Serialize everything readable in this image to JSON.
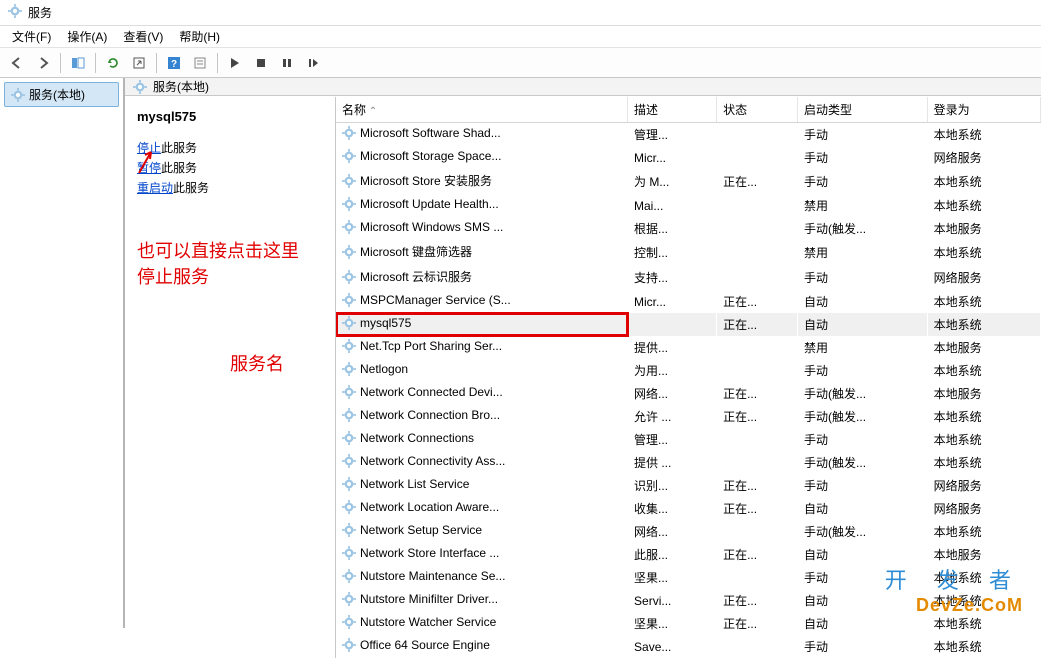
{
  "window": {
    "title": "服务"
  },
  "menu": {
    "file": "文件(F)",
    "action": "操作(A)",
    "view": "查看(V)",
    "help": "帮助(H)"
  },
  "tree": {
    "root": "服务(本地)"
  },
  "pane": {
    "header": "服务(本地)"
  },
  "actions": {
    "service_name": "mysql575",
    "stop": "停止",
    "stop_rest": "此服务",
    "pause": "暂停",
    "pause_rest": "此服务",
    "restart": "重启动",
    "restart_rest": "此服务"
  },
  "annots": {
    "arrow_hint": "也可以直接点击这里\n停止服务",
    "service_name_label": "服务名"
  },
  "columns": {
    "name": "名称",
    "desc": "描述",
    "status": "状态",
    "startup": "启动类型",
    "logon": "登录为"
  },
  "services": [
    {
      "name": "Microsoft Software Shad...",
      "desc": "管理...",
      "status": "",
      "startup": "手动",
      "logon": "本地系统"
    },
    {
      "name": "Microsoft Storage Space...",
      "desc": "Micr...",
      "status": "",
      "startup": "手动",
      "logon": "网络服务"
    },
    {
      "name": "Microsoft Store 安装服务",
      "desc": "为 M...",
      "status": "正在...",
      "startup": "手动",
      "logon": "本地系统"
    },
    {
      "name": "Microsoft Update Health...",
      "desc": "Mai...",
      "status": "",
      "startup": "禁用",
      "logon": "本地系统"
    },
    {
      "name": "Microsoft Windows SMS ...",
      "desc": "根据...",
      "status": "",
      "startup": "手动(触发...",
      "logon": "本地服务"
    },
    {
      "name": "Microsoft 键盘筛选器",
      "desc": "控制...",
      "status": "",
      "startup": "禁用",
      "logon": "本地系统"
    },
    {
      "name": "Microsoft 云标识服务",
      "desc": "支持...",
      "status": "",
      "startup": "手动",
      "logon": "网络服务"
    },
    {
      "name": "MSPCManager Service (S...",
      "desc": "Micr...",
      "status": "正在...",
      "startup": "自动",
      "logon": "本地系统"
    },
    {
      "name": "mysql575",
      "desc": "",
      "status": "正在...",
      "startup": "自动",
      "logon": "本地系统",
      "highlight": true,
      "selected": true
    },
    {
      "name": "Net.Tcp Port Sharing Ser...",
      "desc": "提供...",
      "status": "",
      "startup": "禁用",
      "logon": "本地服务"
    },
    {
      "name": "Netlogon",
      "desc": "为用...",
      "status": "",
      "startup": "手动",
      "logon": "本地系统"
    },
    {
      "name": "Network Connected Devi...",
      "desc": "网络...",
      "status": "正在...",
      "startup": "手动(触发...",
      "logon": "本地服务"
    },
    {
      "name": "Network Connection Bro...",
      "desc": "允许 ...",
      "status": "正在...",
      "startup": "手动(触发...",
      "logon": "本地系统"
    },
    {
      "name": "Network Connections",
      "desc": "管理...",
      "status": "",
      "startup": "手动",
      "logon": "本地系统"
    },
    {
      "name": "Network Connectivity Ass...",
      "desc": "提供 ...",
      "status": "",
      "startup": "手动(触发...",
      "logon": "本地系统"
    },
    {
      "name": "Network List Service",
      "desc": "识别...",
      "status": "正在...",
      "startup": "手动",
      "logon": "网络服务"
    },
    {
      "name": "Network Location Aware...",
      "desc": "收集...",
      "status": "正在...",
      "startup": "自动",
      "logon": "网络服务"
    },
    {
      "name": "Network Setup Service",
      "desc": "网络...",
      "status": "",
      "startup": "手动(触发...",
      "logon": "本地系统"
    },
    {
      "name": "Network Store Interface ...",
      "desc": "此服...",
      "status": "正在...",
      "startup": "自动",
      "logon": "本地服务"
    },
    {
      "name": "Nutstore Maintenance Se...",
      "desc": "坚果...",
      "status": "",
      "startup": "手动",
      "logon": "本地系统"
    },
    {
      "name": "Nutstore Minifilter Driver...",
      "desc": "Servi...",
      "status": "正在...",
      "startup": "自动",
      "logon": "本地系统"
    },
    {
      "name": "Nutstore Watcher Service",
      "desc": "坚果...",
      "status": "正在...",
      "startup": "自动",
      "logon": "本地系统"
    },
    {
      "name": "Office 64 Source Engine",
      "desc": "Save...",
      "status": "",
      "startup": "手动",
      "logon": "本地系统"
    }
  ],
  "watermark": {
    "l1": "开 发 者",
    "l2": "DevZe.CoM"
  }
}
